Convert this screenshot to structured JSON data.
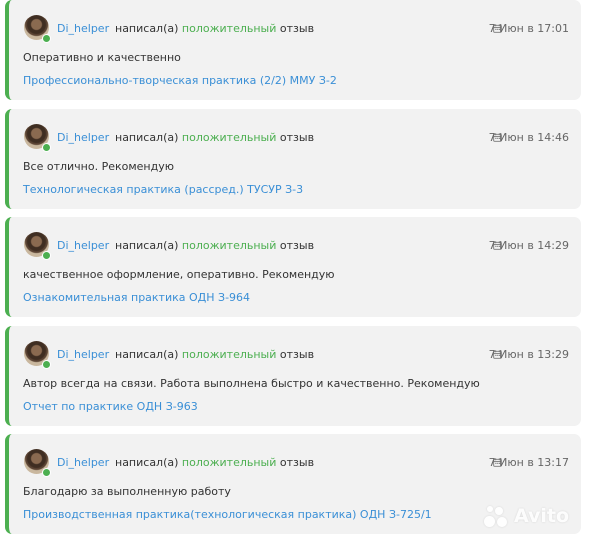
{
  "reviews": [
    {
      "username": "Di_helper",
      "action_prefix": "написал(а)",
      "sentiment": "положительный",
      "action_suffix": "отзыв",
      "date": "7 Июн в 17:01",
      "comment": "Оперативно и качественно",
      "work": "Профессионально-творческая практика (2/2) ММУ З-2"
    },
    {
      "username": "Di_helper",
      "action_prefix": "написал(а)",
      "sentiment": "положительный",
      "action_suffix": "отзыв",
      "date": "7 Июн в 14:46",
      "comment": "Все отлично. Рекомендую",
      "work": "Технологическая практика (рассред.) ТУСУР З-3"
    },
    {
      "username": "Di_helper",
      "action_prefix": "написал(а)",
      "sentiment": "положительный",
      "action_suffix": "отзыв",
      "date": "7 Июн в 14:29",
      "comment": "качественное оформление, оперативно. Рекомендую",
      "work": "Ознакомительная практика ОДН З-964"
    },
    {
      "username": "Di_helper",
      "action_prefix": "написал(а)",
      "sentiment": "положительный",
      "action_suffix": "отзыв",
      "date": "7 Июн в 13:29",
      "comment": "Автор всегда на связи. Работа выполнена быстро и качественно. Рекомендую",
      "work": "Отчет по практике ОДН З-963"
    },
    {
      "username": "Di_helper",
      "action_prefix": "написал(а)",
      "sentiment": "положительный",
      "action_suffix": "отзыв",
      "date": "7 Июн в 13:17",
      "comment": "Благодарю за выполненную работу",
      "work": "Производственная практика(технологическая практика) ОДН З-725/1"
    }
  ],
  "watermark": "Avito",
  "colors": {
    "accent_green": "#4caf50",
    "link_blue": "#3a8fd6",
    "card_bg": "#f2f2f2"
  },
  "icons": {
    "date": "calendar-icon",
    "status": "online-dot"
  }
}
